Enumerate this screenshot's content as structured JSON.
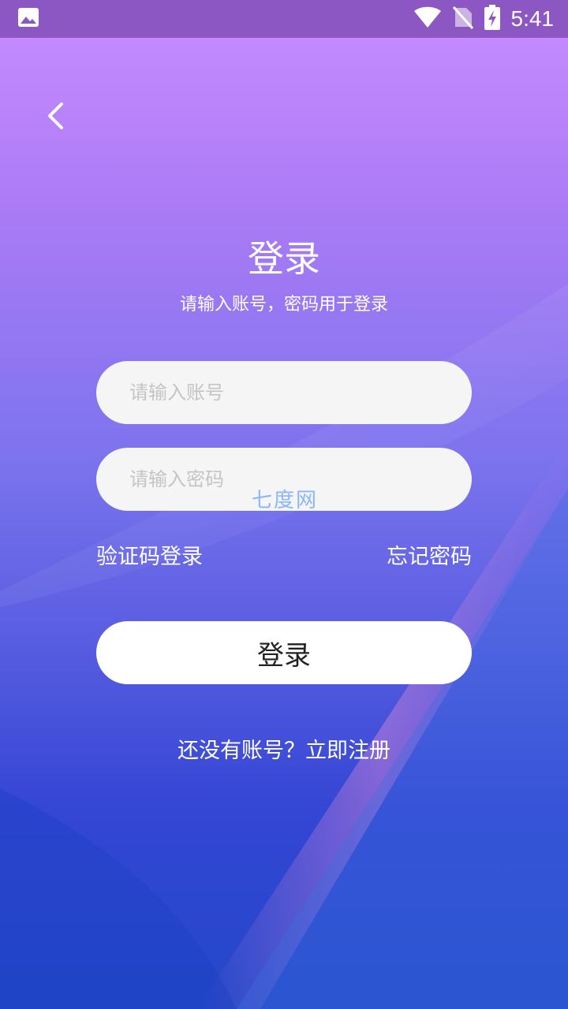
{
  "status_bar": {
    "time": "5:41",
    "icons": [
      "image-icon",
      "wifi-icon",
      "no-sim-icon",
      "battery-charging-icon"
    ],
    "background": "#8c57c2"
  },
  "login": {
    "title": "登录",
    "subtitle": "请输入账号，密码用于登录",
    "account_placeholder": "请输入账号",
    "password_placeholder": "请输入密码",
    "sms_login": "验证码登录",
    "forgot_password": "忘记密码",
    "login_button": "登录",
    "register_prompt": "还没有账号？立即注册"
  },
  "watermark": {
    "text": "七度网"
  },
  "colors": {
    "gradient_top": "#c98cff",
    "gradient_bottom": "#2248c9",
    "field_bg": "#f5f5f5",
    "button_bg": "#ffffff"
  }
}
